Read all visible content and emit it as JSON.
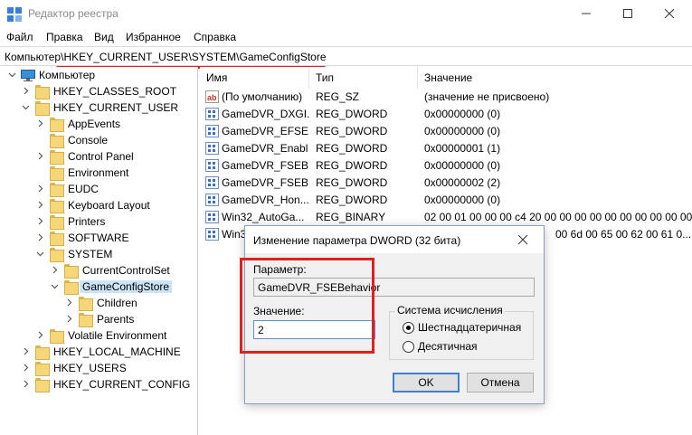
{
  "window": {
    "title": "Редактор реестра"
  },
  "menu": [
    "Файл",
    "Правка",
    "Вид",
    "Избранное",
    "Справка"
  ],
  "address": {
    "path": "Компьютер\\HKEY_CURRENT_USER\\SYSTEM\\GameConfigStore"
  },
  "tree": {
    "root": "Компьютер",
    "items": [
      "HKEY_CLASSES_ROOT",
      "HKEY_CURRENT_USER",
      "AppEvents",
      "Console",
      "Control Panel",
      "Environment",
      "EUDC",
      "Keyboard Layout",
      "Printers",
      "SOFTWARE",
      "SYSTEM",
      "CurrentControlSet",
      "GameConfigStore",
      "Children",
      "Parents",
      "Volatile Environment",
      "HKEY_LOCAL_MACHINE",
      "HKEY_USERS",
      "HKEY_CURRENT_CONFIG"
    ]
  },
  "list": {
    "columns": [
      "Имя",
      "Тип",
      "Значение"
    ],
    "rows": [
      {
        "icon": "string-value-icon",
        "name": "(По умолчанию)",
        "type": "REG_SZ",
        "value": "(значение не присвоено)"
      },
      {
        "icon": "binary-value-icon",
        "name": "GameDVR_DXGI...",
        "type": "REG_DWORD",
        "value": "0x00000000 (0)"
      },
      {
        "icon": "binary-value-icon",
        "name": "GameDVR_EFSE...",
        "type": "REG_DWORD",
        "value": "0x00000000 (0)"
      },
      {
        "icon": "binary-value-icon",
        "name": "GameDVR_Enabl",
        "type": "REG_DWORD",
        "value": "0x00000001 (1)"
      },
      {
        "icon": "binary-value-icon",
        "name": "GameDVR_FSEB...",
        "type": "REG_DWORD",
        "value": "0x00000000 (0)"
      },
      {
        "icon": "binary-value-icon",
        "name": "GameDVR_FSEB...",
        "type": "REG_DWORD",
        "value": "0x00000002 (2)"
      },
      {
        "icon": "binary-value-icon",
        "name": "GameDVR_Hon...",
        "type": "REG_DWORD",
        "value": "0x00000000 (0)"
      },
      {
        "icon": "binary-value-icon",
        "name": "Win32_AutoGa...",
        "type": "REG_BINARY",
        "value": "02 00 01 00 00 00 c4 20 00 00 00 00 00 00 00 00 00 00 00 ..."
      },
      {
        "icon": "binary-value-icon",
        "name": "Win3",
        "type": "",
        "value": "00 6d 00 65 00 62 00 61 0..."
      }
    ]
  },
  "dialog": {
    "title": "Изменение параметра DWORD (32 бита)",
    "param_label": "Параметр:",
    "param_value": "GameDVR_FSEBehavior",
    "value_label": "Значение:",
    "value_input": "2",
    "base_label": "Система исчисления",
    "hex_label": "Шестнадцатеричная",
    "dec_label": "Десятичная",
    "ok": "OK",
    "cancel": "Отмена"
  },
  "colors": {
    "highlight": "#e02020",
    "selection": "#cce4f7",
    "accent": "#3c7fd4"
  }
}
